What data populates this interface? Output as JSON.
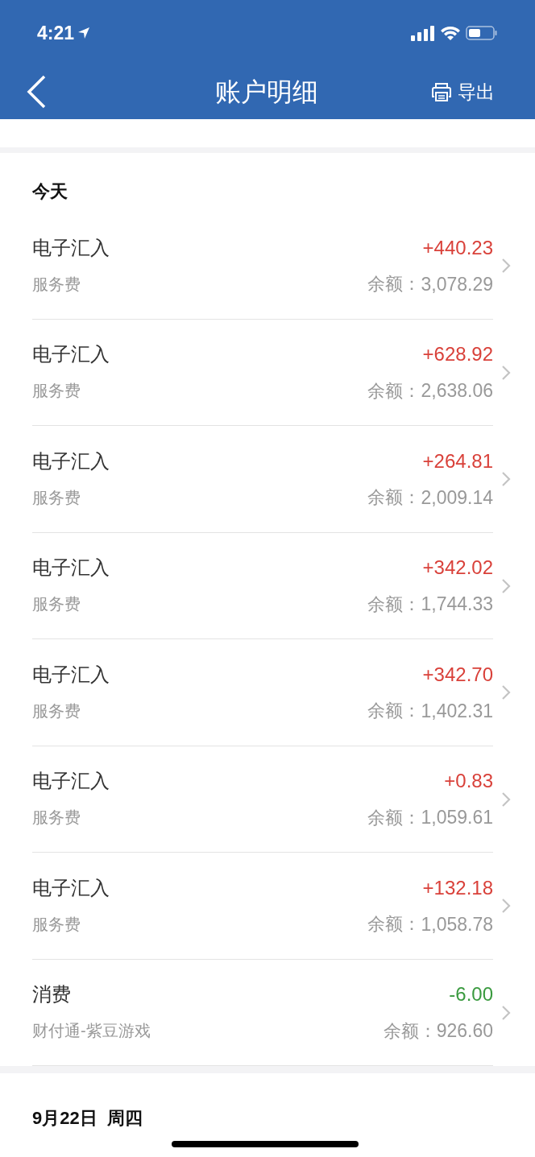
{
  "status_bar": {
    "time": "4:21"
  },
  "nav": {
    "title": "账户明细",
    "action": "导出"
  },
  "sections": [
    {
      "header": "今天",
      "rows": [
        {
          "title": "电子汇入",
          "subtitle": "服务费",
          "amount": "+440.23",
          "kind": "income",
          "balance_label": "余额：",
          "balance": "3,078.29"
        },
        {
          "title": "电子汇入",
          "subtitle": "服务费",
          "amount": "+628.92",
          "kind": "income",
          "balance_label": "余额：",
          "balance": "2,638.06"
        },
        {
          "title": "电子汇入",
          "subtitle": "服务费",
          "amount": "+264.81",
          "kind": "income",
          "balance_label": "余额：",
          "balance": "2,009.14"
        },
        {
          "title": "电子汇入",
          "subtitle": "服务费",
          "amount": "+342.02",
          "kind": "income",
          "balance_label": "余额：",
          "balance": "1,744.33"
        },
        {
          "title": "电子汇入",
          "subtitle": "服务费",
          "amount": "+342.70",
          "kind": "income",
          "balance_label": "余额：",
          "balance": "1,402.31"
        },
        {
          "title": "电子汇入",
          "subtitle": "服务费",
          "amount": "+0.83",
          "kind": "income",
          "balance_label": "余额：",
          "balance": "1,059.61"
        },
        {
          "title": "电子汇入",
          "subtitle": "服务费",
          "amount": "+132.18",
          "kind": "income",
          "balance_label": "余额：",
          "balance": "1,058.78"
        },
        {
          "title": "消费",
          "subtitle": "财付通-紫豆游戏",
          "amount": "-6.00",
          "kind": "expense",
          "balance_label": "余额：",
          "balance": "926.60"
        }
      ]
    },
    {
      "header": "9月22日  周四"
    }
  ]
}
